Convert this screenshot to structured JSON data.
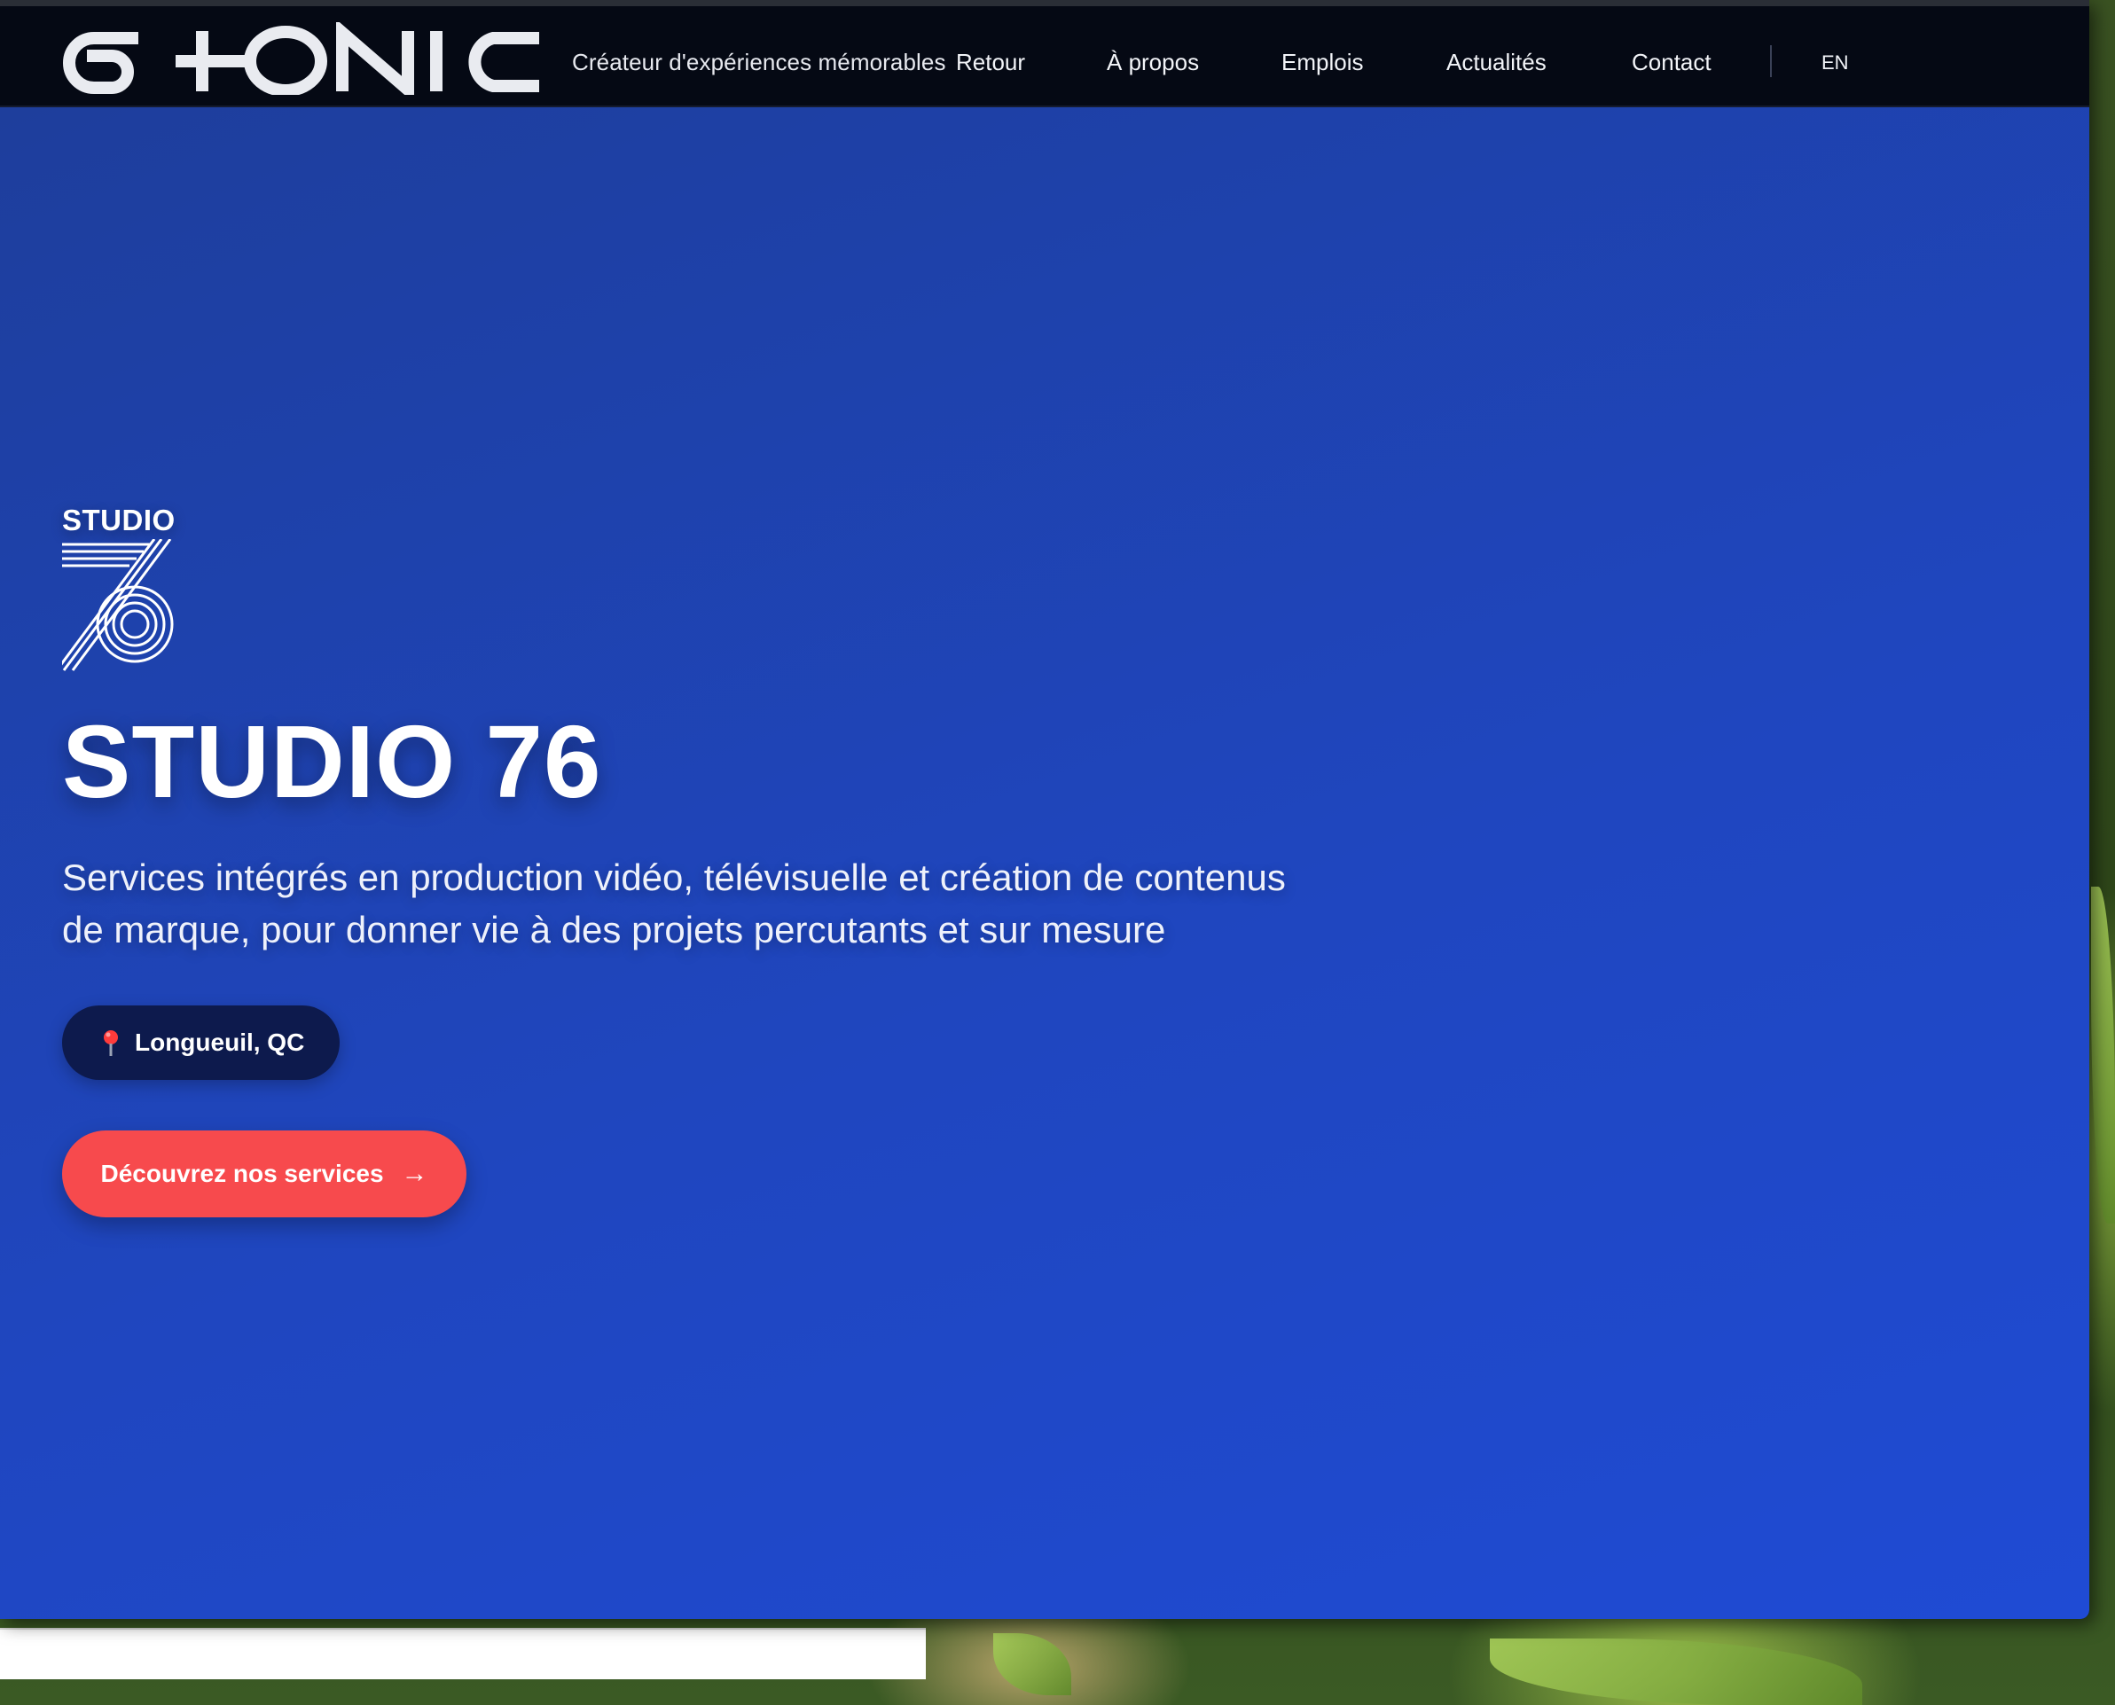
{
  "brand": {
    "logo_text": "G+ONIC",
    "tagline": "Créateur d'expériences mémorables"
  },
  "nav": {
    "items": [
      {
        "label": "Retour"
      },
      {
        "label": "À propos"
      },
      {
        "label": "Emplois"
      },
      {
        "label": "Actualités"
      },
      {
        "label": "Contact"
      }
    ],
    "language": "EN"
  },
  "hero": {
    "logo_word": "STUDIO",
    "logo_number": "76",
    "title": "STUDIO 76",
    "description": "Services intégrés en production vidéo, télévisuelle et création de contenus de marque, pour donner vie à des projets percutants et sur mesure",
    "location": "Longueuil, QC",
    "location_icon": "map-pin-icon",
    "cta_label": "Découvrez nos services",
    "cta_icon": "arrow-right-icon"
  },
  "colors": {
    "nav_bg": "#050914",
    "hero_start": "#1e3e9c",
    "hero_end": "#1f4bd4",
    "badge_bg": "#0d1a4d",
    "cta_bg": "#f74a4d"
  }
}
